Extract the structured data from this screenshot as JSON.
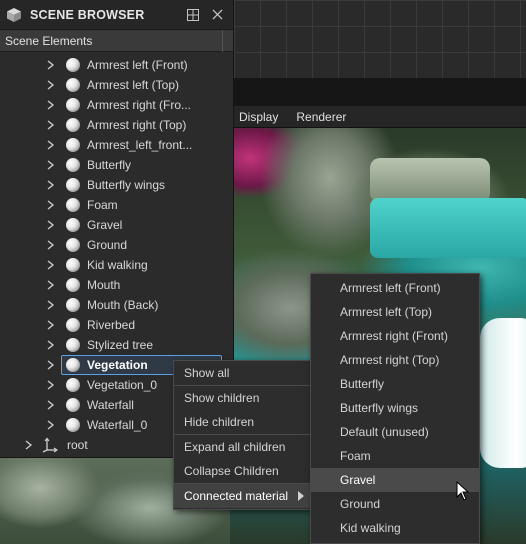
{
  "panel": {
    "title": "SCENE BROWSER",
    "column_header": "Scene Elements",
    "items": [
      {
        "label": "Armrest left (Front)"
      },
      {
        "label": "Armrest left (Top)"
      },
      {
        "label": "Armrest right (Fro..."
      },
      {
        "label": "Armrest right (Top)"
      },
      {
        "label": "Armrest_left_front..."
      },
      {
        "label": "Butterfly"
      },
      {
        "label": "Butterfly wings"
      },
      {
        "label": "Foam"
      },
      {
        "label": "Gravel"
      },
      {
        "label": "Ground"
      },
      {
        "label": "Kid walking"
      },
      {
        "label": "Mouth"
      },
      {
        "label": "Mouth (Back)"
      },
      {
        "label": "Riverbed"
      },
      {
        "label": "Stylized tree"
      },
      {
        "label": "Vegetation",
        "selected": true
      },
      {
        "label": "Vegetation_0"
      },
      {
        "label": "Waterfall"
      },
      {
        "label": "Waterfall_0"
      }
    ],
    "root_label": "root"
  },
  "viewport_menu": [
    "Display",
    "Renderer"
  ],
  "context_menu": {
    "items": [
      "Show all",
      "Show children",
      "Hide children",
      "Expand all children",
      "Collapse Children",
      "Connected material"
    ]
  },
  "submenu": {
    "items": [
      "Armrest left (Front)",
      "Armrest left (Top)",
      "Armrest right (Front)",
      "Armrest right (Top)",
      "Butterfly",
      "Butterfly wings",
      "Default (unused)",
      "Foam",
      "Gravel",
      "Ground",
      "Kid walking"
    ],
    "hovered": "Gravel"
  },
  "colors": {
    "selection_border": "#5aa0e6",
    "panel_bg": "#2b2b2b",
    "menu_bg": "#2d2d2d"
  }
}
